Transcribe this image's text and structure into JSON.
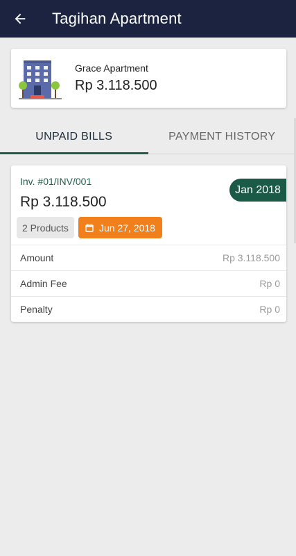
{
  "appbar": {
    "title": "Tagihan Apartment",
    "back_icon": "arrow-left-icon",
    "background": "#1b2340"
  },
  "property": {
    "name": "Grace Apartment",
    "amount": "Rp 3.118.500",
    "icon": "apartment-building-icon"
  },
  "tabs": [
    {
      "label": "UNPAID BILLS",
      "active": true
    },
    {
      "label": "PAYMENT HISTORY",
      "active": false
    }
  ],
  "bill": {
    "invoice": "Inv. #01/INV/001",
    "total": "Rp 3.118.500",
    "period": "Jan 2018",
    "products": "2 Products",
    "due_date": "Jun 27, 2018",
    "calendar_icon": "calendar-icon",
    "fees": [
      {
        "label": "Amount",
        "value": "Rp 3.118.500"
      },
      {
        "label": "Admin Fee",
        "value": "Rp 0"
      },
      {
        "label": "Penalty",
        "value": "Rp 0"
      }
    ]
  },
  "colors": {
    "accent_green": "#1f5e4c",
    "badge_orange": "#f07f1c",
    "background": "#ececec"
  }
}
